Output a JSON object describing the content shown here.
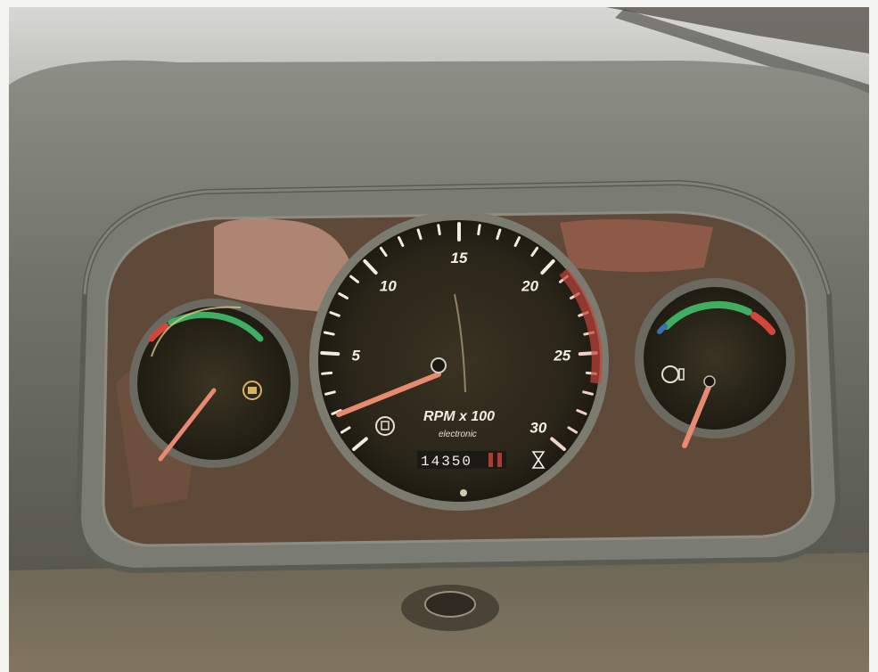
{
  "tachometer": {
    "scale_labels": [
      "5",
      "10",
      "15",
      "20",
      "25",
      "30"
    ],
    "unit_label": "RPM x 100",
    "subtitle": "electronic",
    "odometer": "14350",
    "needle_level_rpm_x100": 1
  },
  "left_gauge": {
    "icon": "engine-temperature-warning-icon",
    "needle_level": 0.0
  },
  "right_gauge": {
    "icon": "fuel-pump-icon",
    "needle_level": 0.0
  },
  "colors": {
    "dashboard": "#6f7066",
    "gauge_face": "#2d281c",
    "scale_green": "#3fae62",
    "scale_red": "#d4463a",
    "needle": "#e88a72"
  }
}
